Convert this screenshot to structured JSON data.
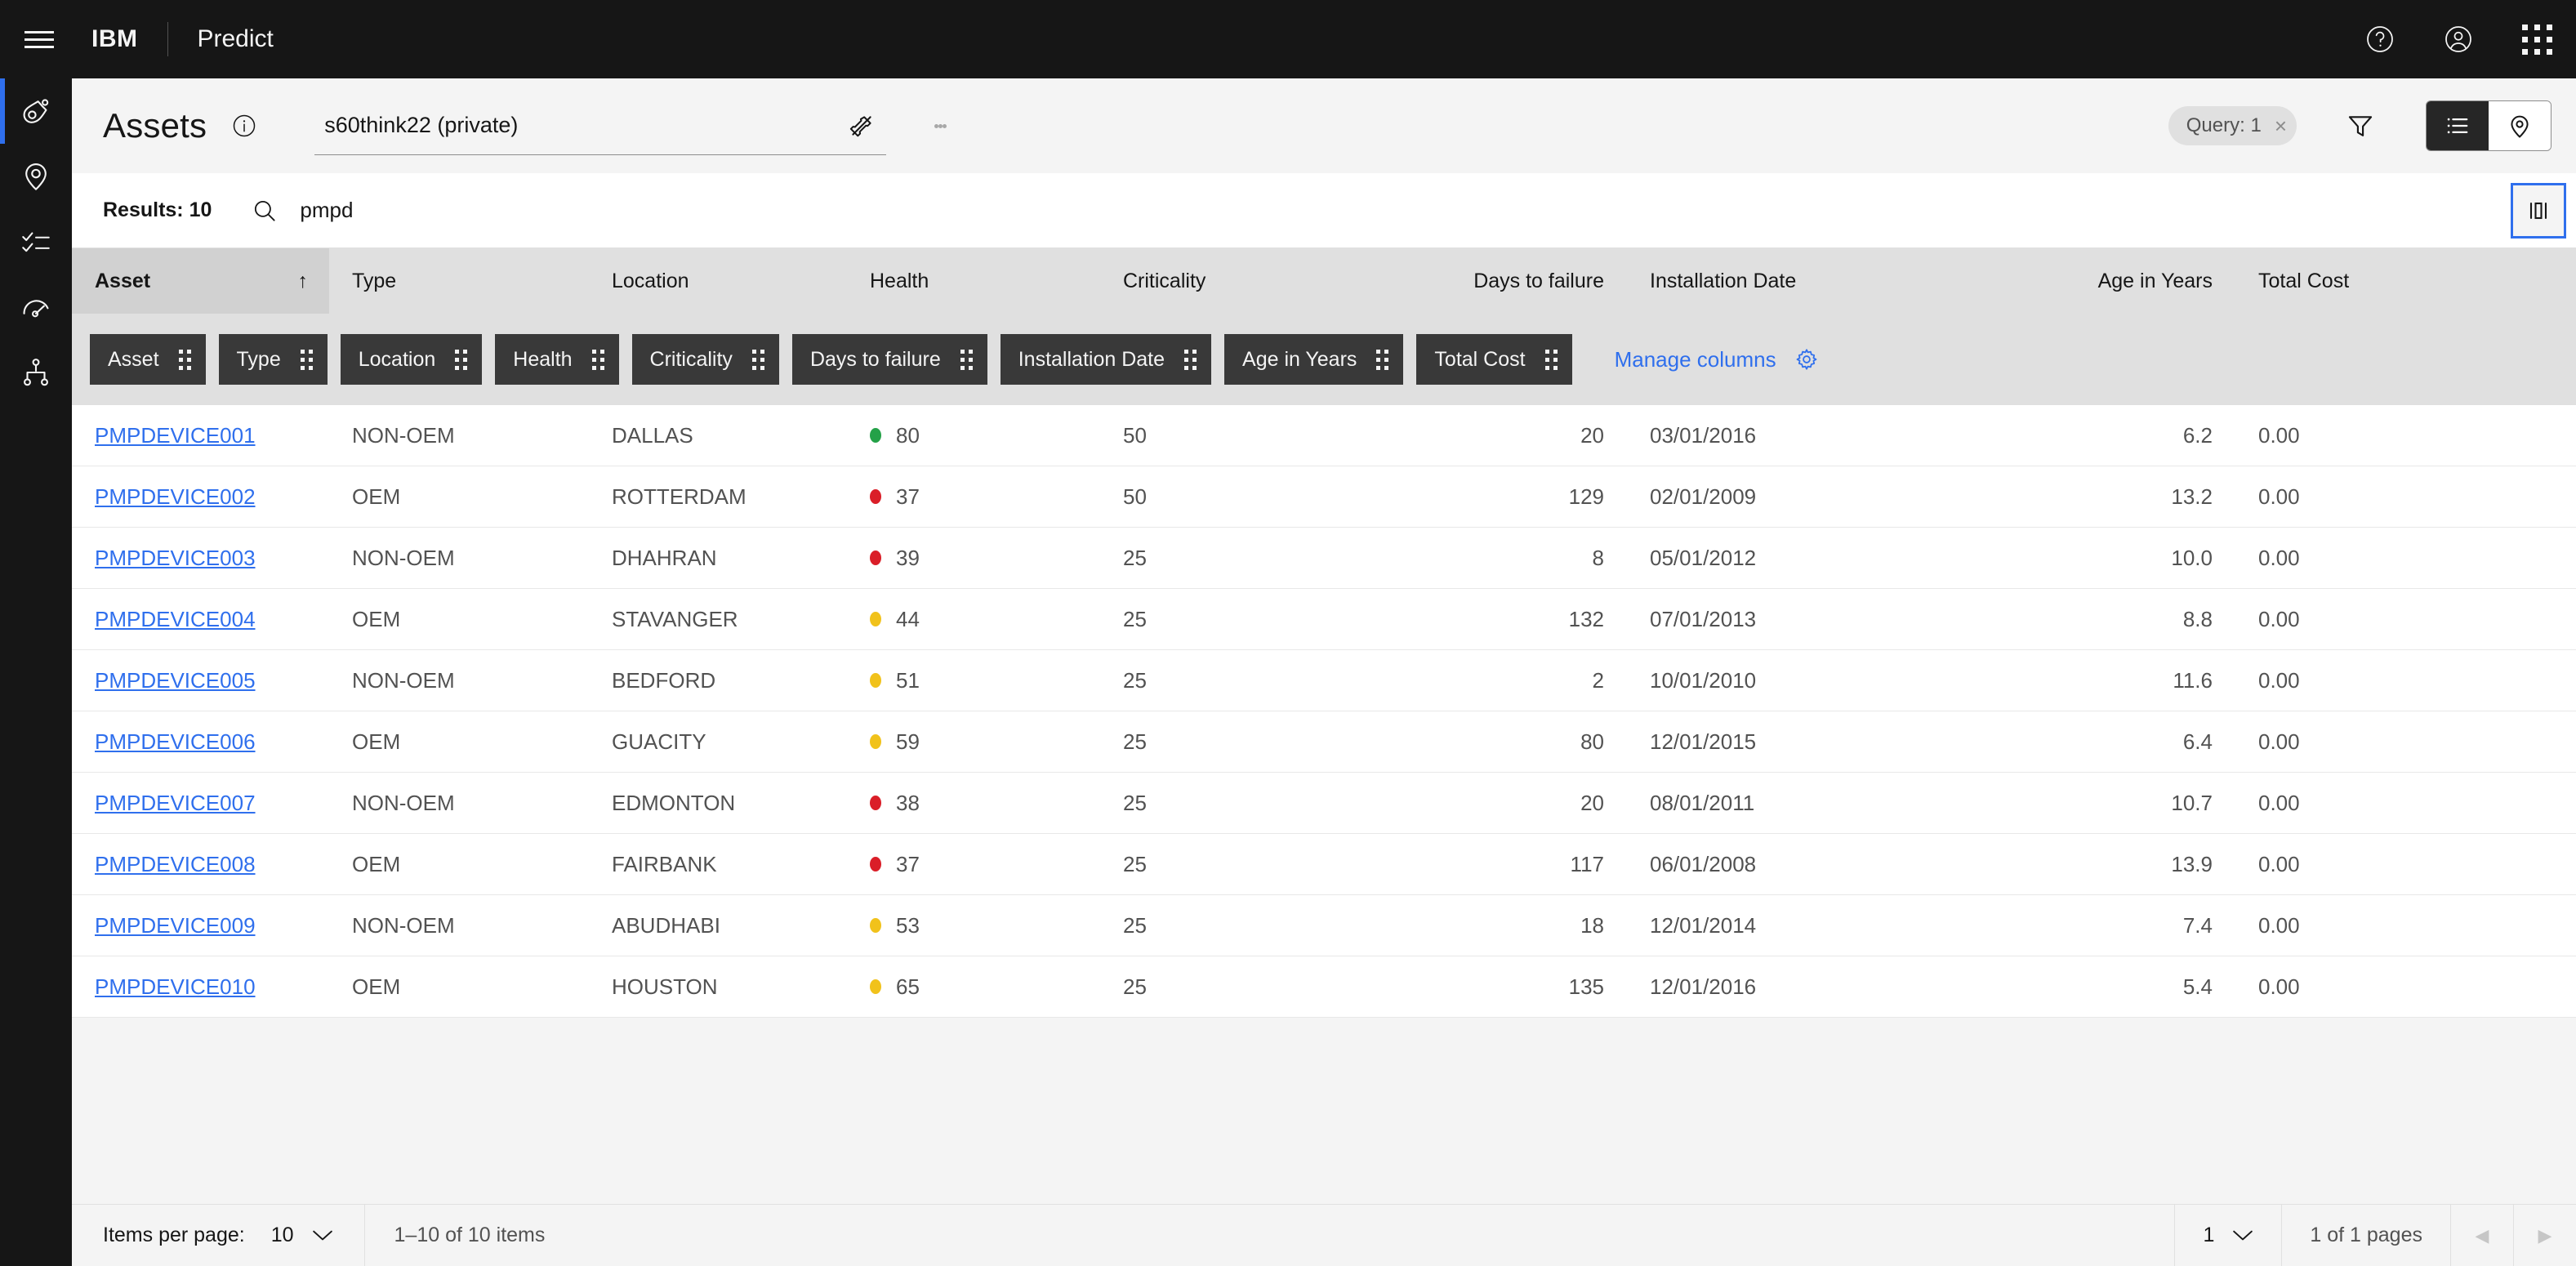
{
  "topbar": {
    "menu_icon": "hamburger-menu-icon",
    "brand": "IBM",
    "product": "Predict",
    "help_icon": "help-icon",
    "account_icon": "user-avatar-icon",
    "switcher_icon": "app-switcher-icon"
  },
  "rail": {
    "items": [
      {
        "icon": "asset-icon",
        "active": true
      },
      {
        "icon": "location-pin-icon",
        "active": false
      },
      {
        "icon": "task-checklist-icon",
        "active": false
      },
      {
        "icon": "gauge-meter-icon",
        "active": false
      },
      {
        "icon": "hierarchy-tree-icon",
        "active": false
      }
    ]
  },
  "header": {
    "title": "Assets",
    "info_icon": "information-icon",
    "query_value": "s60think22 (private)",
    "unpin_icon": "pin-off-icon",
    "overflow_icon": "overflow-menu-icon",
    "query_tag": "Query: 1",
    "query_tag_close": "×",
    "filter_icon": "filter-icon",
    "view_list_icon": "list-view-icon",
    "view_map_icon": "map-view-icon"
  },
  "results": {
    "count_label": "Results: 10",
    "search_icon": "search-icon",
    "search_value": "pmpd",
    "search_placeholder": "Search",
    "panel_toggle_icon": "side-panel-icon"
  },
  "table": {
    "sort_column": "Asset",
    "sort_arrow": "↑",
    "columns": [
      {
        "label": "Asset",
        "class": "c-asset",
        "align": "left"
      },
      {
        "label": "Type",
        "class": "c-type",
        "align": "left"
      },
      {
        "label": "Location",
        "class": "c-loc",
        "align": "left"
      },
      {
        "label": "Health",
        "class": "c-health",
        "align": "left"
      },
      {
        "label": "Criticality",
        "class": "c-crit",
        "align": "left"
      },
      {
        "label": "Days to failure",
        "class": "c-days",
        "align": "right"
      },
      {
        "label": "Installation Date",
        "class": "c-inst",
        "align": "left"
      },
      {
        "label": "Age in Years",
        "class": "c-age",
        "align": "right"
      },
      {
        "label": "Total Cost",
        "class": "c-cost",
        "align": "left"
      }
    ],
    "chips": [
      "Asset",
      "Type",
      "Location",
      "Health",
      "Criticality",
      "Days to failure",
      "Installation Date",
      "Age in Years",
      "Total Cost"
    ],
    "manage_columns_label": "Manage columns",
    "manage_columns_icon": "gear-icon",
    "health_colors": {
      "good": "#24a148",
      "warning": "#f1c21b",
      "critical": "#da1e28"
    },
    "rows": [
      {
        "asset": "PMPDEVICE001",
        "type": "NON-OEM",
        "location": "DALLAS",
        "health": "80",
        "health_state": "good",
        "criticality": "50",
        "days": "20",
        "install": "03/01/2016",
        "age": "6.2",
        "cost": "0.00"
      },
      {
        "asset": "PMPDEVICE002",
        "type": "OEM",
        "location": "ROTTERDAM",
        "health": "37",
        "health_state": "critical",
        "criticality": "50",
        "days": "129",
        "install": "02/01/2009",
        "age": "13.2",
        "cost": "0.00"
      },
      {
        "asset": "PMPDEVICE003",
        "type": "NON-OEM",
        "location": "DHAHRAN",
        "health": "39",
        "health_state": "critical",
        "criticality": "25",
        "days": "8",
        "install": "05/01/2012",
        "age": "10.0",
        "cost": "0.00"
      },
      {
        "asset": "PMPDEVICE004",
        "type": "OEM",
        "location": "STAVANGER",
        "health": "44",
        "health_state": "warning",
        "criticality": "25",
        "days": "132",
        "install": "07/01/2013",
        "age": "8.8",
        "cost": "0.00"
      },
      {
        "asset": "PMPDEVICE005",
        "type": "NON-OEM",
        "location": "BEDFORD",
        "health": "51",
        "health_state": "warning",
        "criticality": "25",
        "days": "2",
        "install": "10/01/2010",
        "age": "11.6",
        "cost": "0.00"
      },
      {
        "asset": "PMPDEVICE006",
        "type": "OEM",
        "location": "GUACITY",
        "health": "59",
        "health_state": "warning",
        "criticality": "25",
        "days": "80",
        "install": "12/01/2015",
        "age": "6.4",
        "cost": "0.00"
      },
      {
        "asset": "PMPDEVICE007",
        "type": "NON-OEM",
        "location": "EDMONTON",
        "health": "38",
        "health_state": "critical",
        "criticality": "25",
        "days": "20",
        "install": "08/01/2011",
        "age": "10.7",
        "cost": "0.00"
      },
      {
        "asset": "PMPDEVICE008",
        "type": "OEM",
        "location": "FAIRBANK",
        "health": "37",
        "health_state": "critical",
        "criticality": "25",
        "days": "117",
        "install": "06/01/2008",
        "age": "13.9",
        "cost": "0.00"
      },
      {
        "asset": "PMPDEVICE009",
        "type": "NON-OEM",
        "location": "ABUDHABI",
        "health": "53",
        "health_state": "warning",
        "criticality": "25",
        "days": "18",
        "install": "12/01/2014",
        "age": "7.4",
        "cost": "0.00"
      },
      {
        "asset": "PMPDEVICE010",
        "type": "OEM",
        "location": "HOUSTON",
        "health": "65",
        "health_state": "warning",
        "criticality": "25",
        "days": "135",
        "install": "12/01/2016",
        "age": "5.4",
        "cost": "0.00"
      }
    ]
  },
  "pagination": {
    "items_per_page_label": "Items per page:",
    "items_per_page_value": "10",
    "range_label": "1–10 of 10 items",
    "page_value": "1",
    "pages_label": "1 of 1 pages",
    "prev_icon": "◀",
    "next_icon": "▶",
    "caret": "⌄"
  },
  "colors": {
    "brand_blue": "#2f6fed",
    "header_black": "#161616",
    "chip_gray": "#393939"
  }
}
